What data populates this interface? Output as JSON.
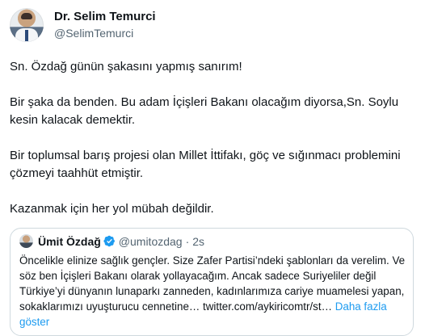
{
  "tweet": {
    "author_name": "Dr. Selim Temurci",
    "author_handle": "@SelimTemurci",
    "paragraphs": [
      "Sn. Özdağ günün şakasını yapmış sanırım!",
      "Bir şaka da benden. Bu adam İçişleri Bakanı olacağım diyorsa,Sn. Soylu kesin kalacak demektir.",
      "Bir toplumsal barış projesi olan Millet İttifakı, göç ve sığınmacı problemini çözmeyi taahhüt etmiştir.",
      "Kazanmak için her yol mübah değildir."
    ]
  },
  "quoted": {
    "author_name": "Ümit Özdağ",
    "author_handle": "@umitozdag",
    "separator": "·",
    "time": "2s",
    "text": "Öncelikle elinize sağlık gençler. Size Zafer Partisi’ndeki şablonları da verelim. Ve söz ben İçişleri Bakanı olarak yollayacağım. Ancak sadece Suriyeliler değil Türkiye’yi dünyanın lunaparkı zanneden, kadınlarımıza cariye muamelesi yapan, sokaklarımızı uyuşturucu cennetine… twitter.com/aykiricomtr/st…",
    "show_more": "Daha fazla göster",
    "verified_color": "#1d9bf0"
  }
}
